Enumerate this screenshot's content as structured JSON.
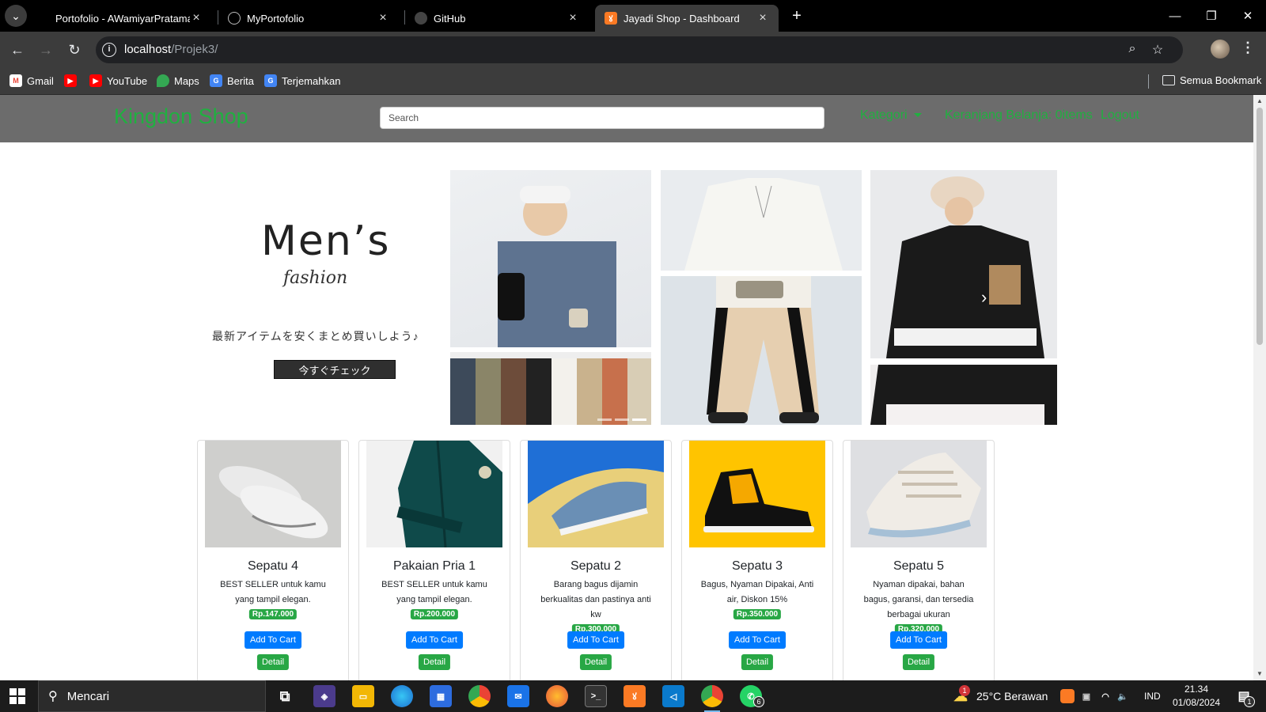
{
  "browser": {
    "tabs": [
      {
        "title": "Portofolio - AWamiyarPratama",
        "icon": "github-icon"
      },
      {
        "title": "MyPortofolio",
        "icon": "globe-icon"
      },
      {
        "title": "GitHub",
        "icon": "github-icon"
      },
      {
        "title": "Jayadi Shop - Dashboard",
        "icon": "xampp-icon",
        "active": true
      }
    ],
    "url_host": "localhost",
    "url_path": "/Projek3/",
    "bookmarks": [
      {
        "label": "Gmail",
        "icon": "gmail-icon",
        "color": "#ea4335"
      },
      {
        "label": "",
        "icon": "youtube-icon",
        "color": "#ff0000"
      },
      {
        "label": "YouTube",
        "icon": "youtube-icon",
        "color": "#ff0000"
      },
      {
        "label": "Maps",
        "icon": "maps-icon",
        "color": "#34a853"
      },
      {
        "label": "Berita",
        "icon": "news-icon",
        "color": "#4285f4"
      },
      {
        "label": "Terjemahkan",
        "icon": "translate-icon",
        "color": "#4285f4"
      }
    ],
    "all_bookmarks": "Semua Bookmark"
  },
  "site": {
    "brand": "Kingdon Shop",
    "search_placeholder": "Search",
    "nav": {
      "kategori": "Kategori",
      "cart": "Keranjang Belanja: 0items",
      "logout": "Logout"
    },
    "accent_color": "#20b040"
  },
  "banner": {
    "title": "Men’s",
    "subtitle": "fashion",
    "jp_text": "最新アイテムを安くまとめ買いしよう♪",
    "jp_button": "今すぐチェック"
  },
  "products": [
    {
      "name": "Sepatu 4",
      "desc": "BEST SELLER untuk kamu yang tampil elegan.",
      "price": "Rp.147.000",
      "cart": "Add To Cart",
      "detail": "Detail"
    },
    {
      "name": "Pakaian Pria 1",
      "desc": "BEST SELLER untuk kamu yang tampil elegan.",
      "price": "Rp.200.000",
      "cart": "Add To Cart",
      "detail": "Detail"
    },
    {
      "name": "Sepatu 2",
      "desc": "Barang bagus dijamin berkualitas dan pastinya anti kw",
      "price": "Rp.300.000",
      "cart": "Add To Cart",
      "detail": "Detail"
    },
    {
      "name": "Sepatu 3",
      "desc": "Bagus, Nyaman Dipakai, Anti air, Diskon 15%",
      "price": "Rp.350.000",
      "cart": "Add To Cart",
      "detail": "Detail"
    },
    {
      "name": "Sepatu 5",
      "desc": "Nyaman dipakai, bahan bagus, garansi, dan tersedia berbagai ukuran",
      "price": "Rp.320.000",
      "cart": "Add To Cart",
      "detail": "Detail"
    }
  ],
  "taskbar": {
    "search_placeholder": "Mencari",
    "weather": "25°C  Berawan",
    "lang": "IND",
    "time": "21.34",
    "date": "01/08/2024",
    "whatsapp_badge": "6",
    "notif_badge": "1",
    "weather_badge": "1"
  }
}
